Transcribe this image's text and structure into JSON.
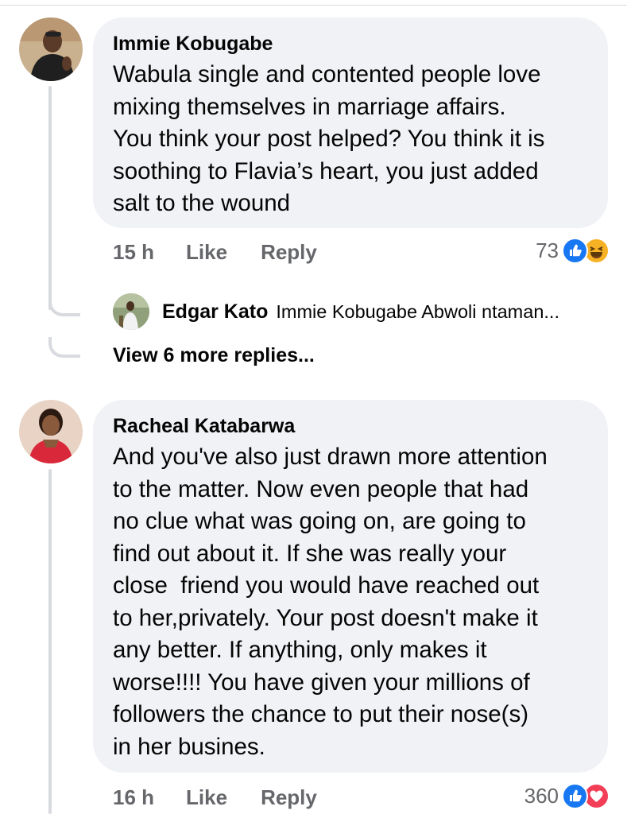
{
  "comments": [
    {
      "author": "Immie Kobugabe",
      "text": "Wabula single and contented people love\nmixing themselves in marriage affairs.\nYou think your post helped? You think it is\nsoothing to Flavia’s heart, you just added\nsalt to the wound",
      "time": "15 h",
      "like_label": "Like",
      "reply_label": "Reply",
      "reaction_count": "73",
      "reactions": [
        "like-icon",
        "haha-icon"
      ],
      "reply_preview": {
        "author": "Edgar Kato",
        "text": "Immie Kobugabe Abwoli ntaman..."
      },
      "view_more_label": "View 6 more replies..."
    },
    {
      "author": "Racheal Katabarwa",
      "text": "And you've also just drawn more attention\nto the matter. Now even people that had\nno clue what was going on, are going to\nfind out about it. If she was really your\nclose  friend you would have reached out\nto her,privately. Your post doesn't make it\nany better. If anything, only makes it\nworse!!!! You have given your millions of\nfollowers the chance to put their nose(s)\nin her busines.",
      "time": "16 h",
      "like_label": "Like",
      "reply_label": "Reply",
      "reaction_count": "360",
      "reactions": [
        "like-icon",
        "love-icon"
      ]
    }
  ],
  "colors": {
    "bubble": "#f0f2f5",
    "meta_text": "#65676b",
    "like_blue": "#1877f2",
    "love_red": "#f33e58",
    "haha_yellow": "#f7b125"
  }
}
